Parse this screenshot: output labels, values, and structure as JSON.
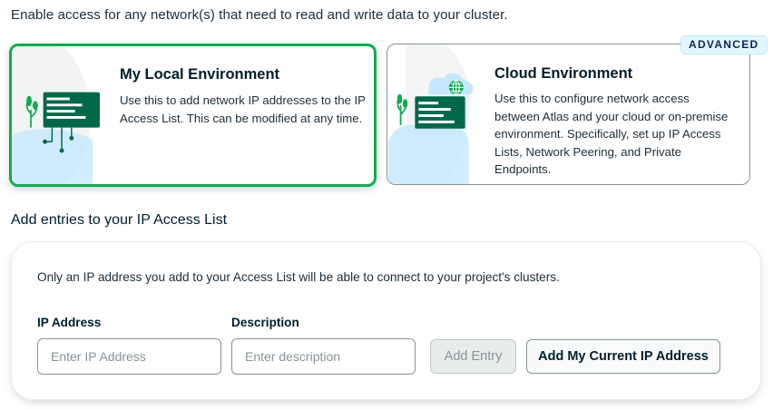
{
  "intro_text": "Enable access for any network(s) that need to read and write data to your cluster.",
  "environments": [
    {
      "title": "My Local Environment",
      "description": "Use this to add network IP addresses to the IP Access List. This can be modified at any time.",
      "selected": true
    },
    {
      "title": "Cloud Environment",
      "description": "Use this to configure network access between Atlas and your cloud or on-premise environment. Specifically, set up IP Access Lists, Network Peering, and Private Endpoints.",
      "selected": false,
      "badge": "ADVANCED"
    }
  ],
  "ip_section": {
    "title": "Add entries to your IP Access List",
    "message": "Only an IP address you add to your Access List will be able to connect to your project's clusters.",
    "ip_label": "IP Address",
    "ip_placeholder": "Enter IP Address",
    "ip_value": "",
    "description_label": "Description",
    "description_placeholder": "Enter description",
    "description_value": "",
    "add_entry_label": "Add Entry",
    "add_current_ip_label": "Add My Current IP Address"
  },
  "colors": {
    "selected_border": "#13aa52",
    "badge_bg": "#e1f7ff",
    "badge_text": "#0c2657",
    "illustration_green": "#00684a",
    "illustration_light": "#c3e7fe"
  },
  "icons": {
    "local_illustration": "server-plant-illustration",
    "cloud_illustration": "cloud-server-globe-illustration"
  }
}
